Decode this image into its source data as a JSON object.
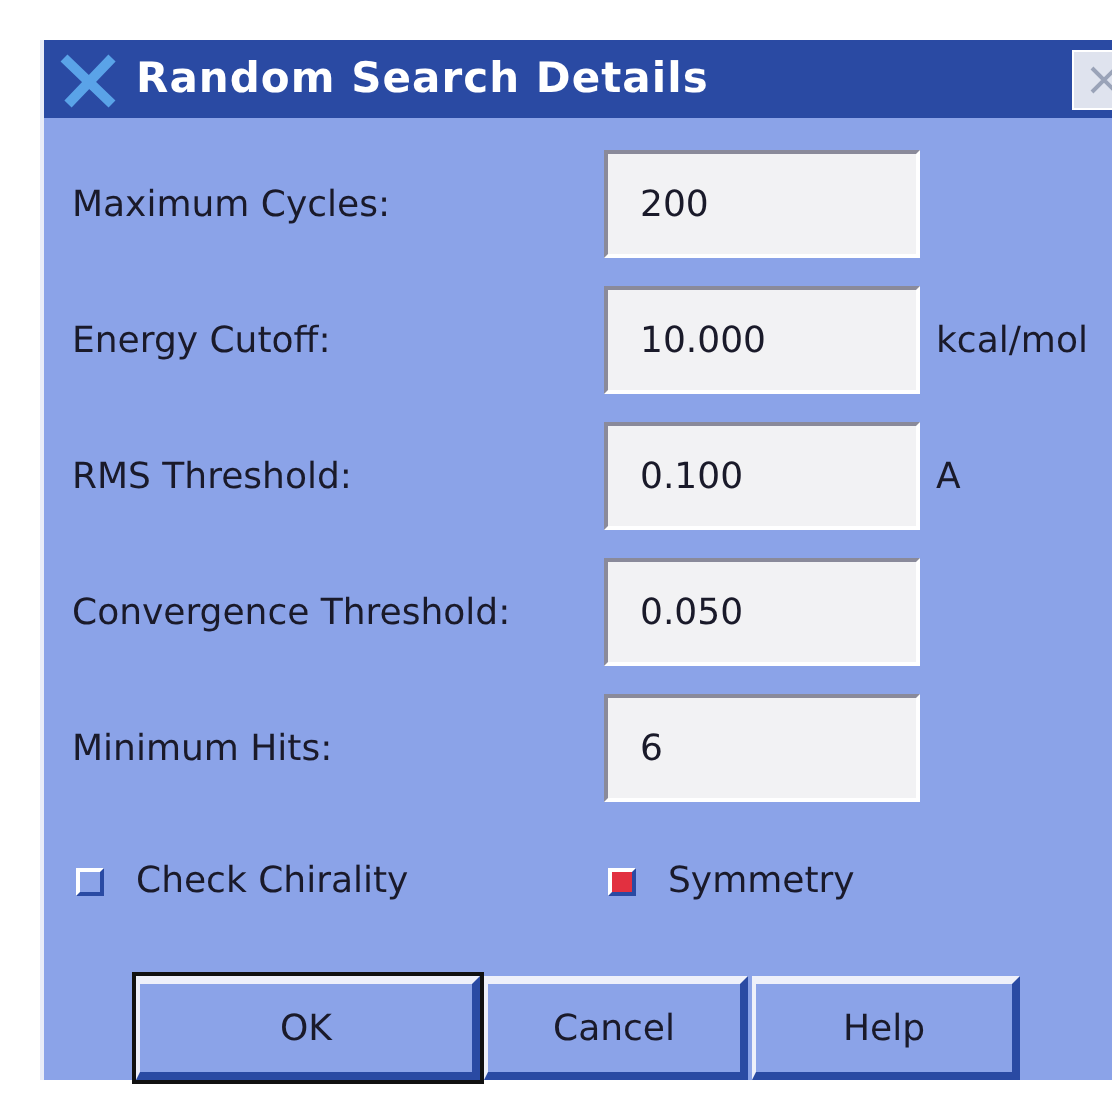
{
  "window": {
    "title": "Random Search Details"
  },
  "fields": [
    {
      "label": "Maximum Cycles:",
      "value": "200"
    },
    {
      "label": "Energy Cutoff:",
      "value": "10.000",
      "unit": "kcal/mol"
    },
    {
      "label": "RMS Threshold:",
      "value": "0.100",
      "unit": "A"
    },
    {
      "label": "Convergence Threshold:",
      "value": "0.050"
    },
    {
      "label": "Minimum Hits:",
      "value": "6"
    }
  ],
  "checkboxes": [
    {
      "label": "Check Chirality",
      "checked": false
    },
    {
      "label": "Symmetry",
      "checked": true
    }
  ],
  "buttons": [
    {
      "label": "OK",
      "selected": true
    },
    {
      "label": "Cancel",
      "selected": false
    },
    {
      "label": "Help",
      "selected": false
    }
  ]
}
